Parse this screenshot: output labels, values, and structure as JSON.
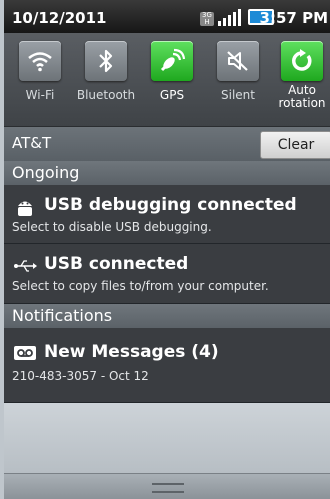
{
  "statusbar": {
    "date": "10/12/2011",
    "time": "3:57 PM"
  },
  "toggles": [
    {
      "label": "Wi-Fi",
      "icon": "wifi-icon",
      "on": false
    },
    {
      "label": "Bluetooth",
      "icon": "bluetooth-icon",
      "on": false
    },
    {
      "label": "GPS",
      "icon": "gps-icon",
      "on": true
    },
    {
      "label": "Silent",
      "icon": "silent-icon",
      "on": false
    },
    {
      "label": "Auto rotation",
      "icon": "rotation-icon",
      "on": true
    }
  ],
  "carrier": {
    "name": "AT&T",
    "clear_label": "Clear"
  },
  "sections": {
    "ongoing": "Ongoing",
    "notifications": "Notifications"
  },
  "ongoing_items": [
    {
      "title": "USB debugging connected",
      "subtitle": "Select to disable USB debugging.",
      "icon": "android-icon"
    },
    {
      "title": "USB connected",
      "subtitle": "Select to copy files to/from your computer.",
      "icon": "usb-icon"
    }
  ],
  "notifications": [
    {
      "title": "New Messages (4)",
      "subtitle": "210-483-3057 - Oct 12",
      "icon": "voicemail-icon"
    }
  ],
  "colors": {
    "toggle_on": "#2fbf2f",
    "panel_dark": "#3a3d41",
    "section_bg": "#656c72"
  }
}
